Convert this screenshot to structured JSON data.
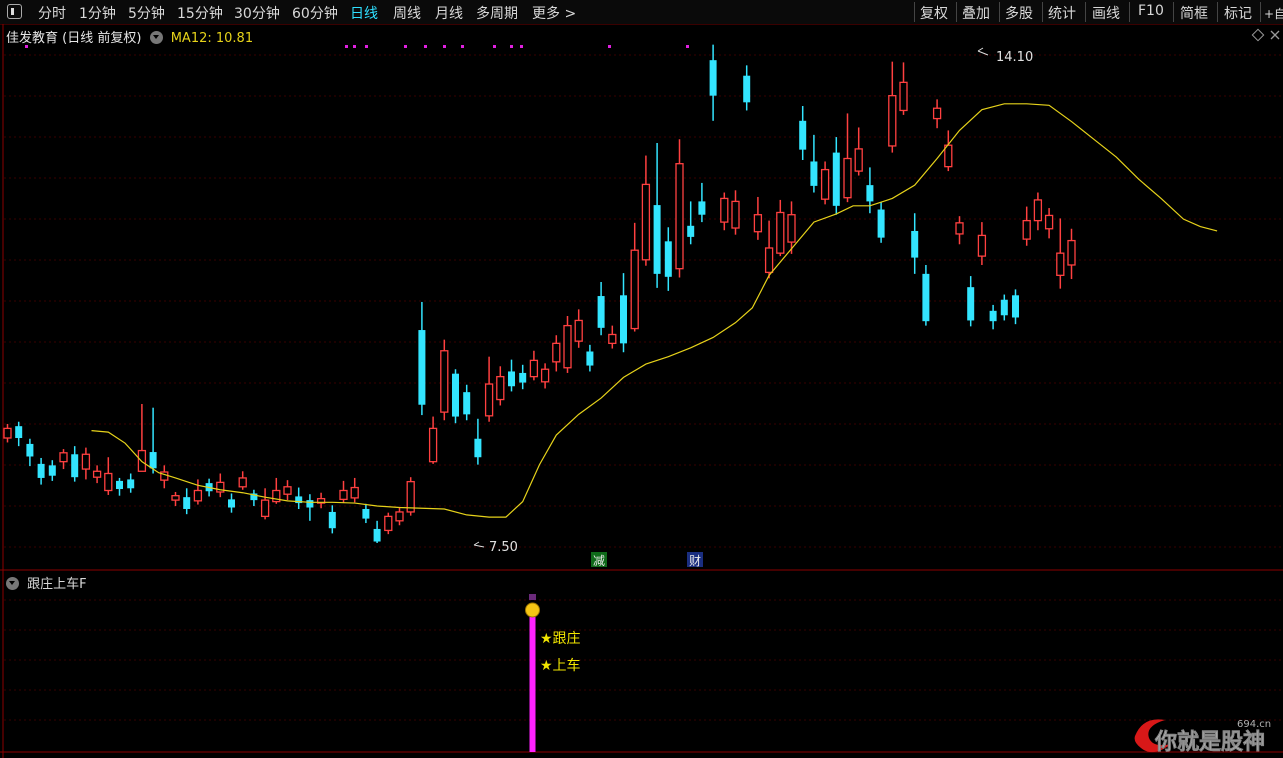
{
  "toolbar": {
    "periods": [
      "分时",
      "1分钟",
      "5分钟",
      "15分钟",
      "30分钟",
      "60分钟",
      "日线",
      "周线",
      "月线",
      "多周期",
      "更多 >"
    ],
    "active_period": "日线",
    "tools": [
      "复权",
      "叠加",
      "多股",
      "统计",
      "画线",
      "F10",
      "简框",
      "标记",
      "+自"
    ]
  },
  "header": {
    "stock_name": "佳发教育",
    "mode": "(日线 前复权)",
    "ma_label": "MA12: 10.81"
  },
  "annotations": {
    "high_label": "14.10",
    "low_label": "7.50",
    "badge_reduce": "减",
    "badge_finance": "财"
  },
  "indicator": {
    "title": "跟庄上车F",
    "signal_label_1": "★跟庄",
    "signal_label_2": "★上车"
  },
  "watermark": {
    "text": "你就是股神",
    "site": "694.cn"
  },
  "colors": {
    "up": "#ff4040",
    "down": "#33e5ff",
    "ma": "#e6d21a",
    "signal": "#ff22ff"
  },
  "chart_data": {
    "type": "candlestick",
    "price_range": [
      7.5,
      14.1
    ],
    "series": {
      "up": [
        [
          8.92,
          9.05,
          9.11,
          8.86
        ],
        [
          8.6,
          8.72,
          8.77,
          8.5
        ],
        [
          8.5,
          8.7,
          8.79,
          8.36
        ],
        [
          8.39,
          8.47,
          8.55,
          8.31
        ],
        [
          8.21,
          8.44,
          8.66,
          8.15
        ],
        [
          8.47,
          8.75,
          9.38,
          8.47
        ],
        [
          8.35,
          8.46,
          8.55,
          8.24
        ],
        [
          8.08,
          8.14,
          8.19,
          8.0
        ],
        [
          8.07,
          8.21,
          8.36,
          8.02
        ],
        [
          8.19,
          8.32,
          8.44,
          8.12
        ],
        [
          8.26,
          8.38,
          8.47,
          8.22
        ],
        [
          7.86,
          8.08,
          8.24,
          7.82
        ],
        [
          8.06,
          8.21,
          8.38,
          8.03
        ],
        [
          8.16,
          8.26,
          8.35,
          8.08
        ],
        [
          8.04,
          8.1,
          8.18,
          7.97
        ],
        [
          8.09,
          8.21,
          8.34,
          8.04
        ],
        [
          8.11,
          8.25,
          8.38,
          8.05
        ],
        [
          7.67,
          7.86,
          7.91,
          7.62
        ],
        [
          7.8,
          7.92,
          7.98,
          7.74
        ],
        [
          7.92,
          8.33,
          8.39,
          7.87
        ],
        [
          8.6,
          9.05,
          9.21,
          8.57
        ],
        [
          9.27,
          10.1,
          10.25,
          9.16
        ],
        [
          9.22,
          9.65,
          10.02,
          9.14
        ],
        [
          9.44,
          9.75,
          9.89,
          9.36
        ],
        [
          9.75,
          9.97,
          10.1,
          9.7
        ],
        [
          9.68,
          9.85,
          9.93,
          9.59
        ],
        [
          9.95,
          10.2,
          10.31,
          9.82
        ],
        [
          9.87,
          10.44,
          10.57,
          9.8
        ],
        [
          10.23,
          10.51,
          10.66,
          10.14
        ],
        [
          10.2,
          10.32,
          10.44,
          10.13
        ],
        [
          10.4,
          11.46,
          11.83,
          10.36
        ],
        [
          11.33,
          12.35,
          12.74,
          11.25
        ],
        [
          11.21,
          12.63,
          12.96,
          11.09
        ],
        [
          11.84,
          12.16,
          12.24,
          11.73
        ],
        [
          11.76,
          12.12,
          12.27,
          11.67
        ],
        [
          11.71,
          11.94,
          12.18,
          11.6
        ],
        [
          11.16,
          11.49,
          11.86,
          11.08
        ],
        [
          11.42,
          11.97,
          12.14,
          11.38
        ],
        [
          11.57,
          11.94,
          12.12,
          11.41
        ],
        [
          12.15,
          12.55,
          12.66,
          12.08
        ],
        [
          12.17,
          12.7,
          13.31,
          12.11
        ],
        [
          12.53,
          12.83,
          13.12,
          12.47
        ],
        [
          12.87,
          13.55,
          14.01,
          12.78
        ],
        [
          13.35,
          13.73,
          14.0,
          13.29
        ],
        [
          13.24,
          13.38,
          13.5,
          13.11
        ],
        [
          12.59,
          12.88,
          13.08,
          12.53
        ],
        [
          11.68,
          11.83,
          11.92,
          11.54
        ],
        [
          11.38,
          11.66,
          11.84,
          11.26
        ],
        [
          11.61,
          11.86,
          12.05,
          11.52
        ],
        [
          11.86,
          12.14,
          12.24,
          11.73
        ],
        [
          11.75,
          11.93,
          12.03,
          11.62
        ],
        [
          11.12,
          11.42,
          11.89,
          10.94
        ],
        [
          11.26,
          11.59,
          11.75,
          11.07
        ]
      ],
      "down": [
        [
          9.08,
          8.92,
          9.14,
          8.81
        ],
        [
          8.84,
          8.67,
          8.91,
          8.54
        ],
        [
          8.57,
          8.38,
          8.65,
          8.29
        ],
        [
          8.55,
          8.41,
          8.62,
          8.34
        ],
        [
          8.7,
          8.39,
          8.81,
          8.33
        ],
        [
          8.34,
          8.23,
          8.38,
          8.14
        ],
        [
          8.36,
          8.24,
          8.44,
          8.18
        ],
        [
          8.73,
          8.51,
          9.33,
          8.44
        ],
        [
          8.12,
          7.96,
          8.24,
          7.89
        ],
        [
          8.31,
          8.2,
          8.37,
          8.13
        ],
        [
          8.09,
          7.98,
          8.17,
          7.91
        ],
        [
          8.17,
          8.08,
          8.22,
          8.0
        ],
        [
          8.13,
          8.04,
          8.25,
          7.96
        ],
        [
          8.08,
          7.98,
          8.16,
          7.8
        ],
        [
          7.92,
          7.7,
          8.01,
          7.63
        ],
        [
          7.96,
          7.83,
          8.03,
          7.77
        ],
        [
          7.69,
          7.52,
          7.8,
          7.5
        ],
        [
          10.38,
          9.37,
          10.76,
          9.23
        ],
        [
          9.79,
          9.21,
          9.85,
          9.12
        ],
        [
          9.54,
          9.24,
          9.64,
          9.16
        ],
        [
          8.91,
          8.66,
          9.18,
          8.56
        ],
        [
          9.82,
          9.62,
          9.98,
          9.55
        ],
        [
          9.8,
          9.67,
          9.91,
          9.58
        ],
        [
          10.09,
          9.9,
          10.18,
          9.82
        ],
        [
          10.84,
          10.41,
          11.03,
          10.31
        ],
        [
          10.85,
          10.2,
          11.15,
          10.08
        ],
        [
          12.07,
          11.14,
          12.91,
          10.95
        ],
        [
          11.58,
          11.1,
          11.77,
          10.91
        ],
        [
          11.79,
          11.64,
          12.12,
          11.54
        ],
        [
          12.12,
          11.94,
          12.37,
          11.84
        ],
        [
          14.03,
          13.55,
          14.24,
          13.21
        ],
        [
          13.82,
          13.46,
          13.96,
          13.35
        ],
        [
          13.21,
          12.82,
          13.41,
          12.68
        ],
        [
          12.66,
          12.33,
          13.02,
          12.24
        ],
        [
          12.78,
          12.06,
          12.99,
          11.94
        ],
        [
          12.34,
          12.12,
          12.58,
          11.96
        ],
        [
          12.01,
          11.63,
          12.11,
          11.56
        ],
        [
          11.72,
          11.36,
          11.96,
          11.14
        ],
        [
          11.14,
          10.5,
          11.26,
          10.44
        ],
        [
          10.96,
          10.51,
          11.11,
          10.43
        ],
        [
          10.64,
          10.5,
          10.72,
          10.39
        ],
        [
          10.79,
          10.58,
          10.86,
          10.51
        ],
        [
          10.85,
          10.55,
          10.93,
          10.46
        ]
      ]
    },
    "ma12": [
      [
        7.5,
        9.02
      ],
      [
        9.0,
        9.0
      ],
      [
        10.5,
        8.85
      ],
      [
        12.0,
        8.6
      ],
      [
        13.5,
        8.45
      ],
      [
        15.0,
        8.38
      ],
      [
        17.0,
        8.28
      ],
      [
        19.0,
        8.22
      ],
      [
        21.0,
        8.18
      ],
      [
        23.0,
        8.12
      ],
      [
        25.0,
        8.07
      ],
      [
        27.0,
        8.05
      ],
      [
        29.0,
        8.05
      ],
      [
        31.0,
        8.04
      ],
      [
        33.0,
        8.0
      ],
      [
        35.0,
        7.98
      ],
      [
        37.0,
        7.97
      ],
      [
        39.0,
        7.96
      ],
      [
        41.0,
        7.88
      ],
      [
        43.0,
        7.85
      ],
      [
        44.5,
        7.85
      ],
      [
        46.0,
        8.06
      ],
      [
        47.5,
        8.56
      ],
      [
        49.0,
        8.96
      ],
      [
        51.0,
        9.24
      ],
      [
        53.0,
        9.46
      ],
      [
        55.0,
        9.74
      ],
      [
        57.0,
        9.92
      ],
      [
        59.0,
        10.02
      ],
      [
        61.0,
        10.14
      ],
      [
        63.0,
        10.28
      ],
      [
        65.0,
        10.48
      ],
      [
        66.5,
        10.68
      ],
      [
        68.0,
        11.12
      ],
      [
        70.0,
        11.48
      ],
      [
        72.0,
        11.84
      ],
      [
        74.0,
        11.95
      ],
      [
        75.5,
        12.06
      ],
      [
        77.0,
        12.06
      ],
      [
        79.0,
        12.16
      ],
      [
        81.0,
        12.34
      ],
      [
        83.0,
        12.7
      ],
      [
        85.0,
        13.08
      ],
      [
        87.0,
        13.36
      ],
      [
        89.0,
        13.44
      ],
      [
        91.0,
        13.44
      ],
      [
        93.0,
        13.42
      ],
      [
        95.0,
        13.2
      ],
      [
        97.0,
        12.96
      ],
      [
        99.0,
        12.72
      ],
      [
        101.0,
        12.42
      ],
      [
        103.0,
        12.16
      ],
      [
        105.0,
        11.88
      ],
      [
        106.5,
        11.78
      ],
      [
        108.0,
        11.72
      ]
    ]
  }
}
